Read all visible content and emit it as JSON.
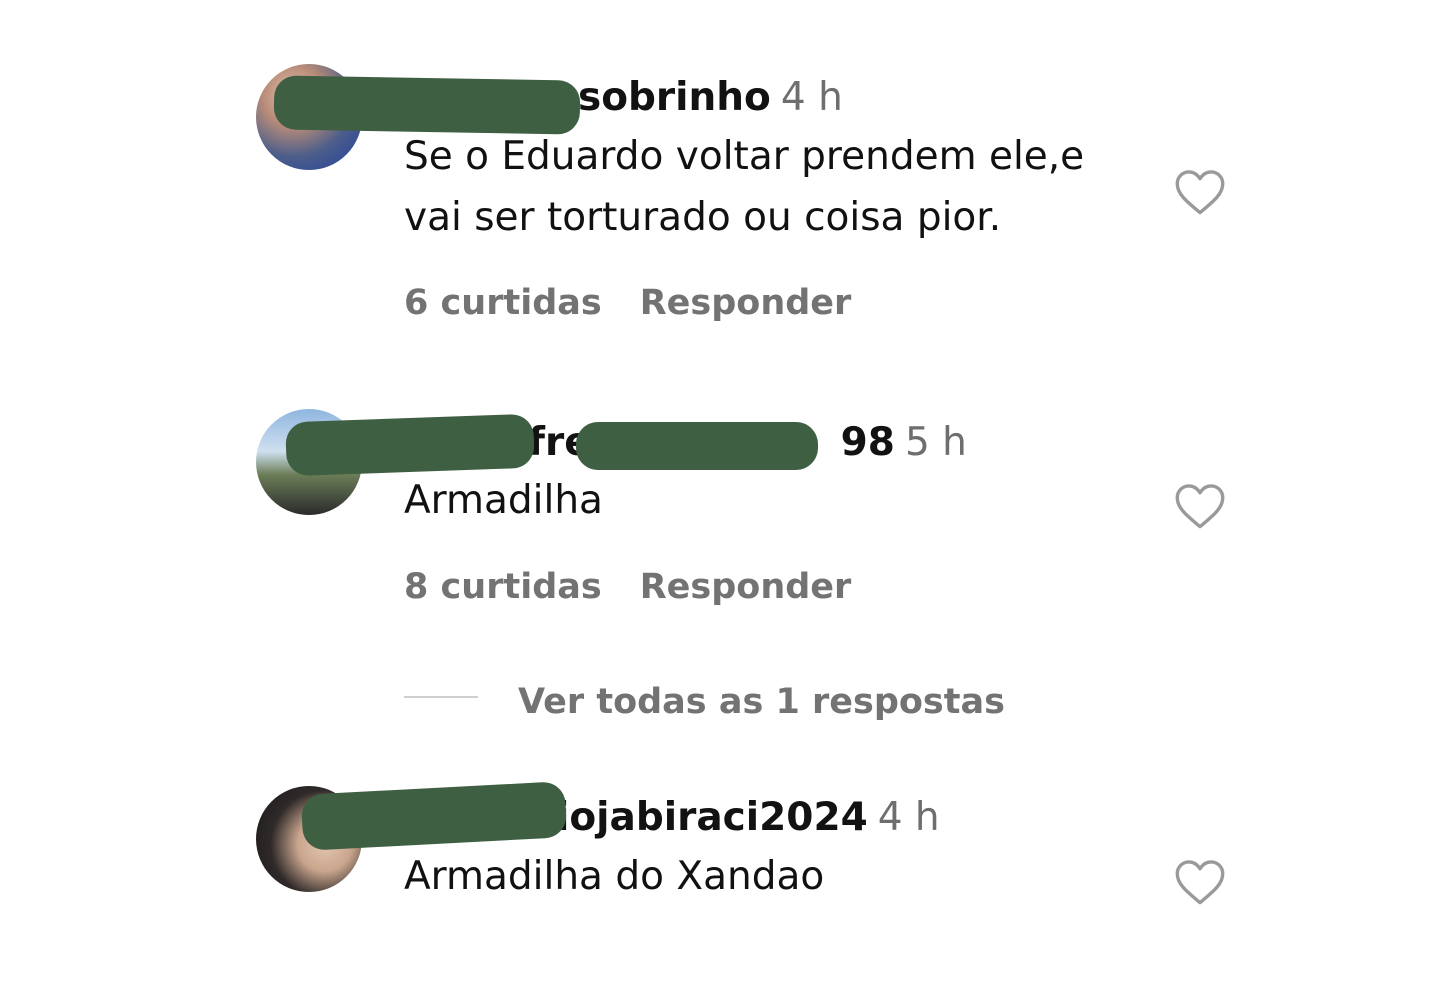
{
  "comments": [
    {
      "username_suffix": "sobrinho",
      "time": "4 h",
      "text": "Se o Eduardo voltar prendem ele,e vai ser torturado ou coisa pior.",
      "likes": "6 curtidas",
      "reply": "Responder"
    },
    {
      "username_fragment_1": "fre",
      "username_fragment_2": "98",
      "time": "5 h",
      "text": "Armadilha",
      "likes": "8 curtidas",
      "reply": "Responder",
      "view_replies": "Ver todas as 1 respostas"
    },
    {
      "username_suffix": "iojabiraci2024",
      "time": "4 h",
      "text": "Armadilha do Xandao"
    }
  ],
  "icons": {
    "like": "heart-outline-icon"
  },
  "colors": {
    "redaction": "#3f5f43",
    "muted": "#737373"
  }
}
